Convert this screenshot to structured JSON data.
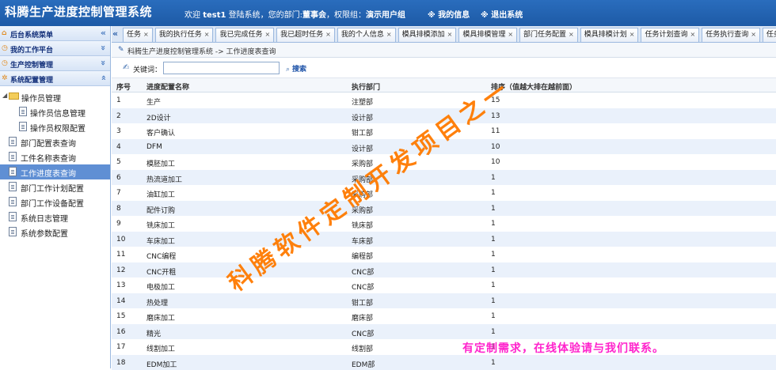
{
  "header": {
    "app_title": "科腾生产进度控制管理系统",
    "welcome_prefix": "欢迎 ",
    "username": "test1",
    "welcome_mid": " 登陆系统，您的部门:",
    "department": "董事会",
    "welcome_group": "，权限组：",
    "group": "演示用户组",
    "my_info": "※ 我的信息",
    "logout": "※ 退出系统"
  },
  "sidebar": {
    "panels": [
      {
        "label": "后台系统菜单",
        "icon": "home-icon",
        "chevron": "«"
      },
      {
        "label": "我的工作平台",
        "icon": "clock-icon",
        "chevron": "»"
      },
      {
        "label": "生产控制管理",
        "icon": "clock-icon",
        "chevron": "»"
      },
      {
        "label": "系统配置管理",
        "icon": "gear-icon",
        "chevron": "»"
      }
    ],
    "tree": [
      {
        "label": "操作员管理",
        "type": "folder"
      },
      {
        "label": "操作员信息管理",
        "type": "leaf"
      },
      {
        "label": "操作员权限配置",
        "type": "leaf"
      },
      {
        "label": "部门配置表查询",
        "type": "page"
      },
      {
        "label": "工件名称表查询",
        "type": "page"
      },
      {
        "label": "工作进度表查询",
        "type": "page",
        "active": true
      },
      {
        "label": "部门工作计划配置",
        "type": "page"
      },
      {
        "label": "部门工作设备配置",
        "type": "page"
      },
      {
        "label": "系统日志管理",
        "type": "page"
      },
      {
        "label": "系统参数配置",
        "type": "page"
      }
    ]
  },
  "tabs": [
    "任务",
    "我的执行任务",
    "我已完成任务",
    "我已超时任务",
    "我的个人信息",
    "模具排模添加",
    "模具排模管理",
    "部门任务配置",
    "模具排模计划",
    "任务计划查询",
    "任务执行查询",
    "任务完"
  ],
  "breadcrumb": "科腾生产进度控制管理系统 -> 工作进度表查询",
  "search": {
    "label": "关键词：",
    "value": "",
    "placeholder": "",
    "button": "搜索"
  },
  "table": {
    "columns": [
      "序号",
      "进度配置名称",
      "执行部门",
      "排序（值越大排在越前面）"
    ],
    "rows": [
      [
        "1",
        "生产",
        "注塑部",
        "15"
      ],
      [
        "2",
        "2D设计",
        "设计部",
        "13"
      ],
      [
        "3",
        "客户确认",
        "钳工部",
        "11"
      ],
      [
        "4",
        "DFM",
        "设计部",
        "10"
      ],
      [
        "5",
        "模胚加工",
        "采购部",
        "10"
      ],
      [
        "6",
        "热流道加工",
        "采购部",
        "1"
      ],
      [
        "7",
        "油缸加工",
        "采购部",
        "1"
      ],
      [
        "8",
        "配件订购",
        "采购部",
        "1"
      ],
      [
        "9",
        "铣床加工",
        "铣床部",
        "1"
      ],
      [
        "10",
        "车床加工",
        "车床部",
        "1"
      ],
      [
        "11",
        "CNC编程",
        "编程部",
        "1"
      ],
      [
        "12",
        "CNC开粗",
        "CNC部",
        "1"
      ],
      [
        "13",
        "电极加工",
        "CNC部",
        "1"
      ],
      [
        "14",
        "热处理",
        "钳工部",
        "1"
      ],
      [
        "15",
        "磨床加工",
        "磨床部",
        "1"
      ],
      [
        "16",
        "精光",
        "CNC部",
        "1"
      ],
      [
        "17",
        "线割加工",
        "线割部",
        "1"
      ],
      [
        "18",
        "EDM加工",
        "EDM部",
        "1"
      ]
    ]
  },
  "watermark": {
    "diagonal": "科腾软件定制开发项目之一",
    "bottom": "有定制需求，在线体验请与我们联系。"
  },
  "colors": {
    "header_bg": "#1d5aa6",
    "active_item": "#5f8fd4",
    "watermark_orange": "#ff7a00",
    "watermark_pink": "#ff22cc"
  }
}
